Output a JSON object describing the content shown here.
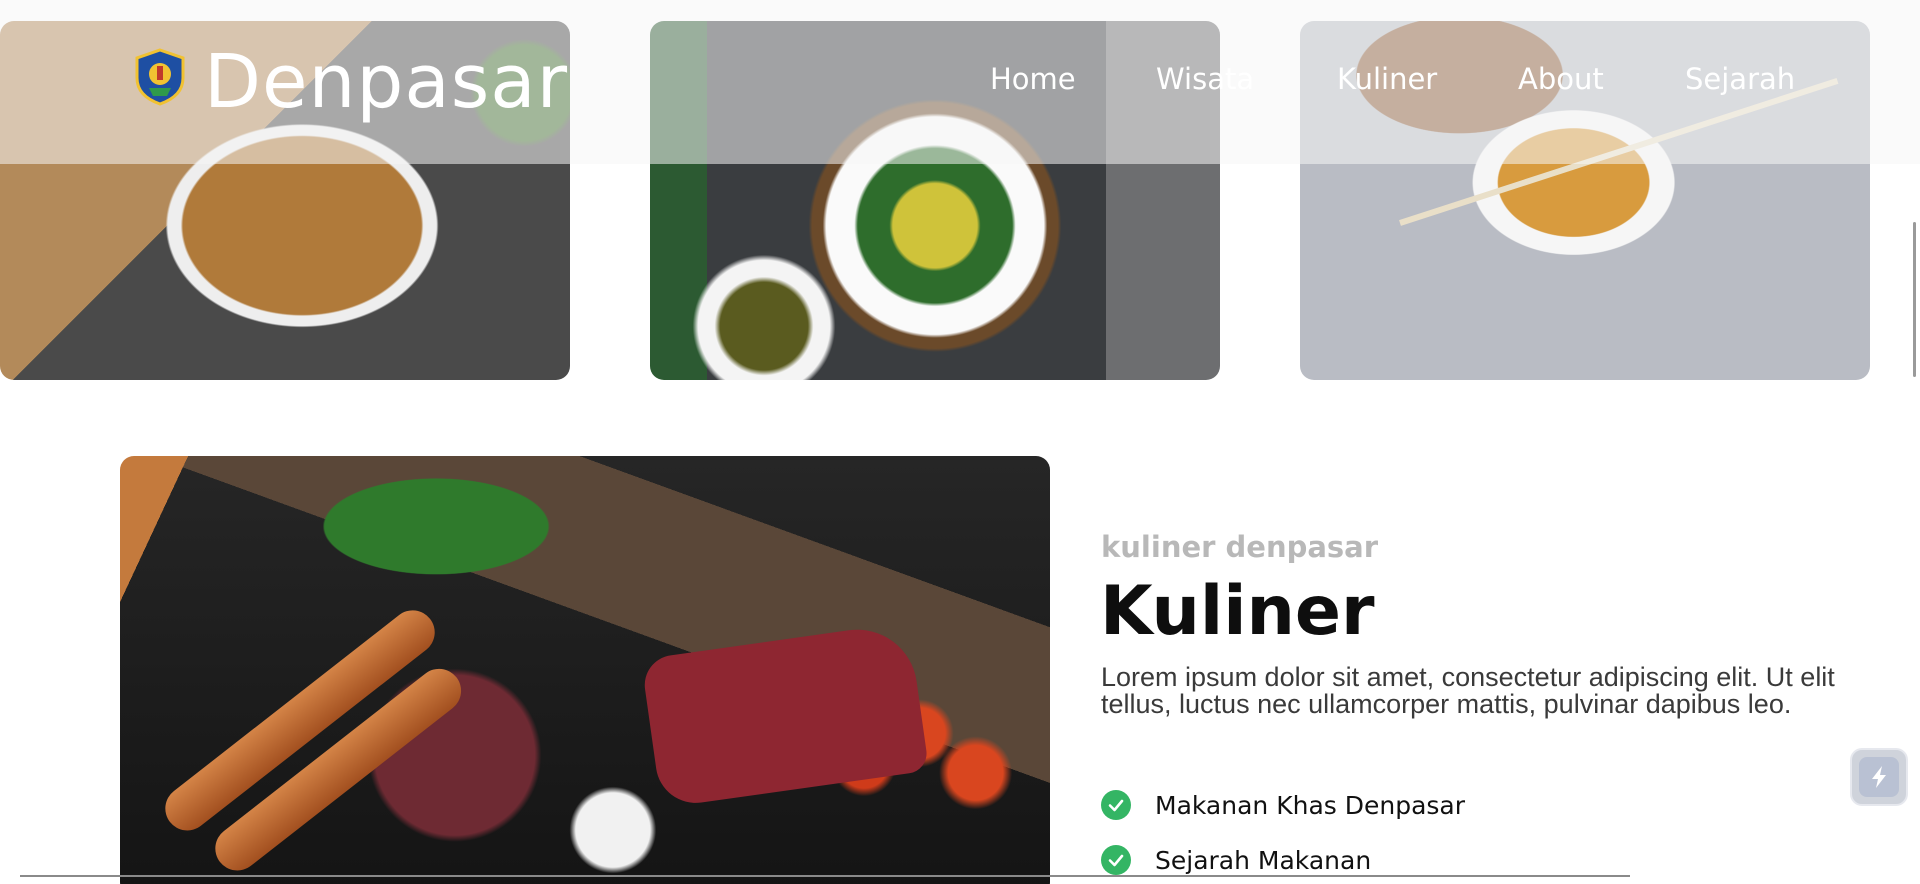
{
  "header": {
    "brand": "Denpasar",
    "nav": [
      "Home",
      "Wisata",
      "Kuliner",
      "About",
      "Sejarah"
    ]
  },
  "gallery": {
    "items": [
      "fried-rice-dish",
      "siomay-dumplings",
      "fried-wonton-bowl"
    ]
  },
  "feature": {
    "image": "meat-platter"
  },
  "content": {
    "eyebrow": "kuliner denpasar",
    "title": "Kuliner",
    "description": "Lorem ipsum dolor sit amet, consectetur adipiscing elit. Ut elit tellus, luctus nec ullamcorper mattis, pulvinar dapibus leo.",
    "list": [
      "Makanan Khas Denpasar",
      "Sejarah Makanan"
    ]
  },
  "colors": {
    "accent_check": "#34b564",
    "title": "#0e0e0e",
    "eyebrow": "#b8b8b8"
  },
  "icons": {
    "logo": "city-emblem-icon",
    "check": "check-circle-icon",
    "widget": "lightning-widget-icon"
  }
}
